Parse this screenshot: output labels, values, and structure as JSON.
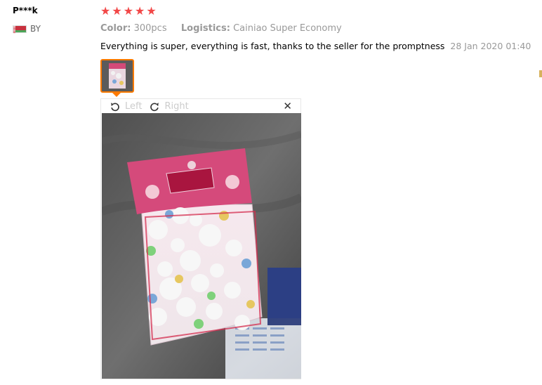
{
  "review": {
    "user_name": "P***k",
    "country_code": "BY",
    "stars": [
      "★",
      "★",
      "★",
      "★",
      "★"
    ],
    "labels": {
      "color_label": "Color:",
      "color_value": "300pcs",
      "logistics_label": "Logistics:",
      "logistics_value": "Cainiao Super Economy"
    },
    "text": "Everything is super, everything is fast, thanks to the seller for the promptness",
    "date": "28 Jan 2020 01:40"
  },
  "viewer": {
    "rotate_left_label": "Left",
    "rotate_right_label": "Right",
    "close_symbol": "✕"
  },
  "colors": {
    "star": "#f24848",
    "thumb_border": "#ff7a00"
  },
  "icons": {
    "rotate_left": "rotate-left-icon",
    "rotate_right": "rotate-right-icon",
    "close": "close-icon"
  }
}
